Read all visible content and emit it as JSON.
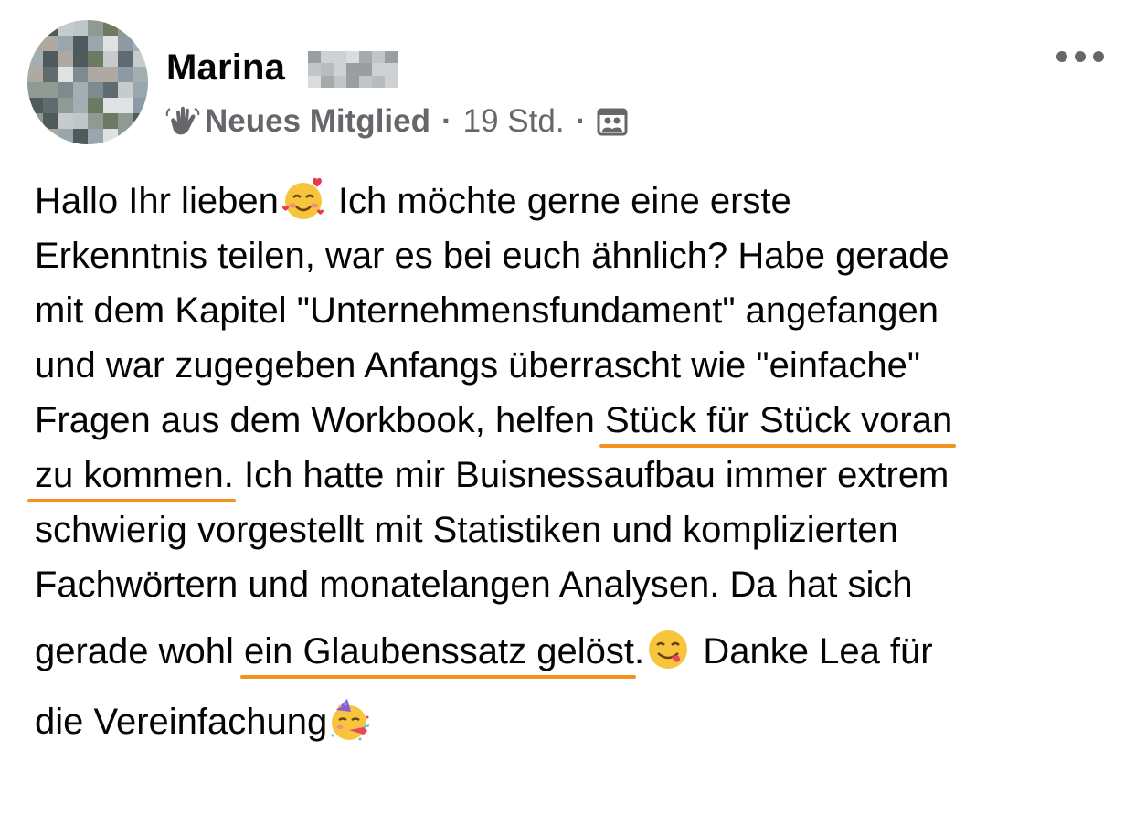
{
  "author": {
    "name": "Marina",
    "badge": "Neues Mitglied",
    "separator": "·",
    "timestamp": "19 Std.",
    "badge_icon": "waving-hand-icon",
    "audience_icon": "group-audience-icon"
  },
  "menu": {
    "icon": "more-options-icon"
  },
  "post": {
    "lines": [
      {
        "a": "Hallo Ihr lieben",
        "b": " Ich möchte gerne eine erste"
      },
      {
        "a": "Erkenntnis teilen, war es bei euch ähnlich? Habe gerade"
      },
      {
        "a": "mit dem Kapitel \"Unternehmensfundament\" angefangen"
      },
      {
        "a": "und war zugegeben Anfangs überrascht wie \"einfache\""
      },
      {
        "a": "Fragen aus dem Workbook, helfen ",
        "hl": "Stück für Stück voran"
      },
      {
        "hl": "zu kommen.",
        "b": " Ich hatte mir Buisnessaufbau immer extrem"
      },
      {
        "a": "schwierig vorgestellt mit Statistiken und komplizierten"
      },
      {
        "a": "Fachwörtern und monatelangen Analysen. Da hat sich"
      },
      {
        "a": "gerade wohl ",
        "hl": "ein Glaubenssatz gelöst",
        "b": ". ",
        "c": " Danke Lea für"
      },
      {
        "a": "die Vereinfachung"
      }
    ],
    "emojis": [
      "smiling-face-with-hearts-icon",
      "face-savoring-food-icon",
      "partying-face-icon"
    ],
    "highlight_color": "#f5921e"
  },
  "colors": {
    "text": "#050505",
    "secondary": "#65676b",
    "background": "#ffffff"
  }
}
